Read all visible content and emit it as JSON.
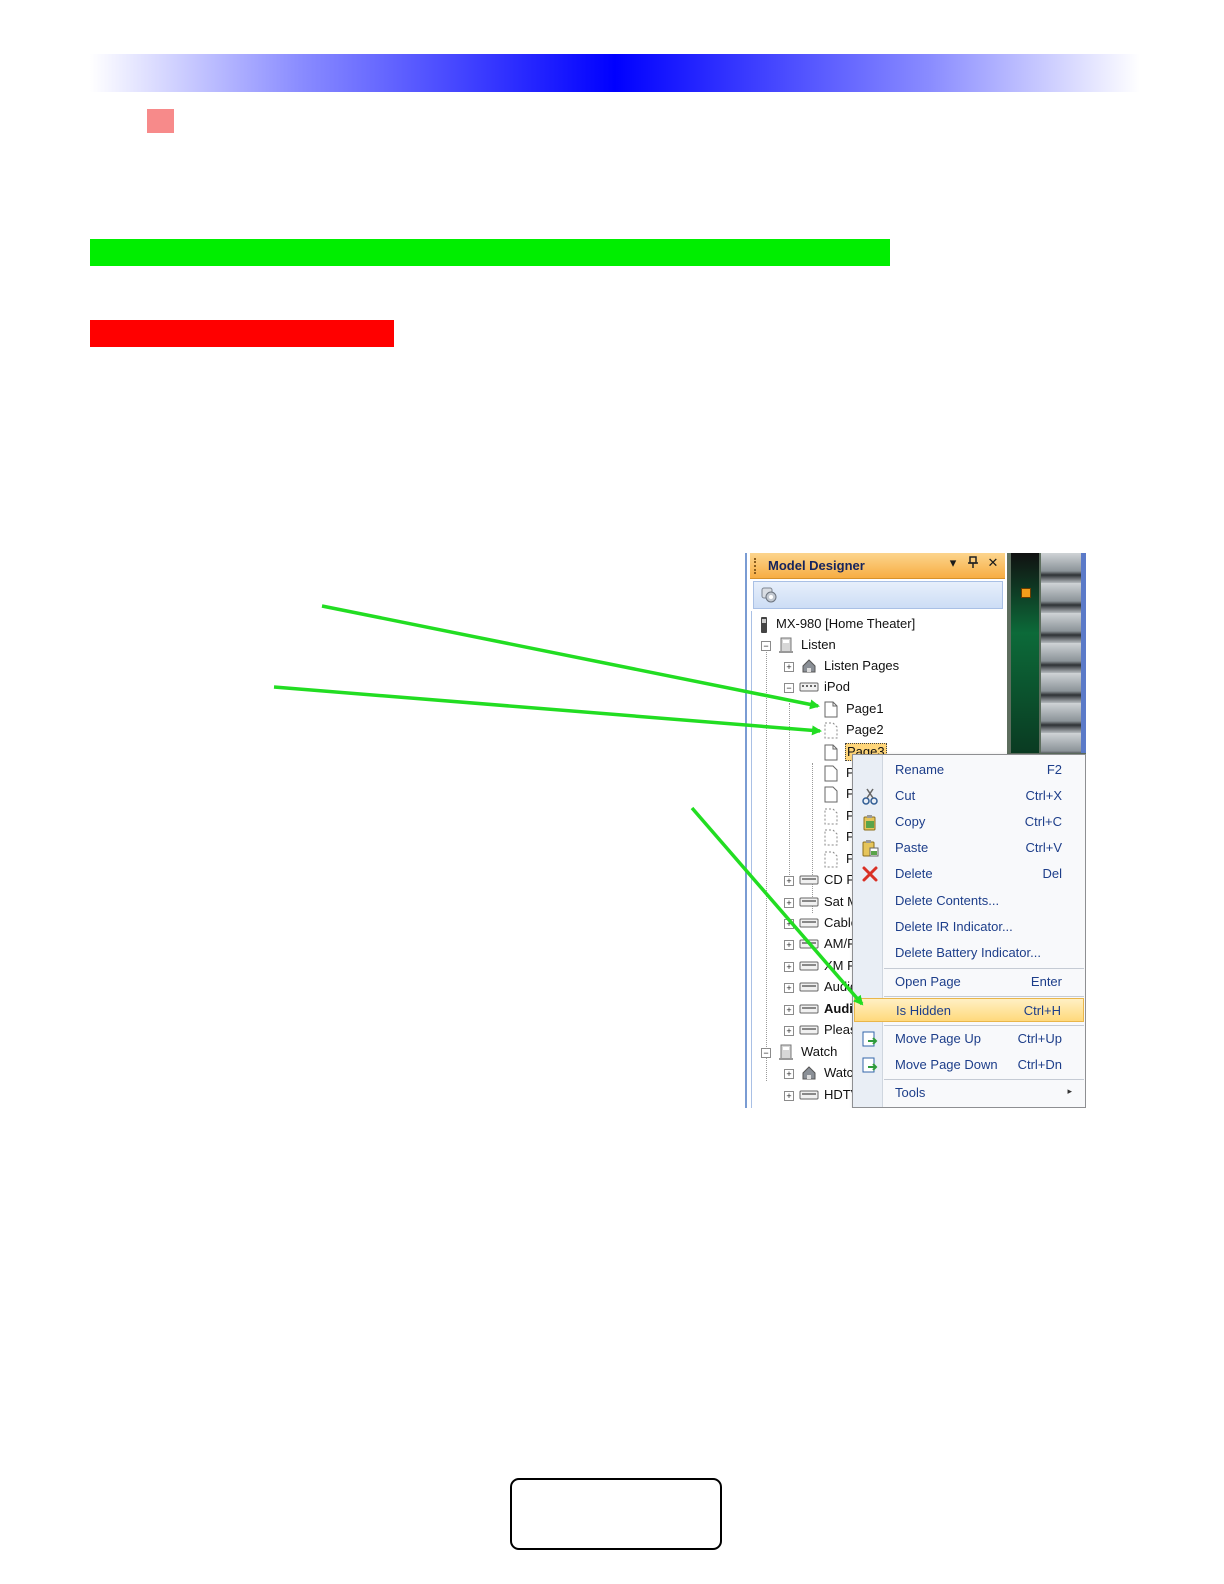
{
  "colors": {
    "header_gradient_center": "#0000ff",
    "green_bar": "#00ee00",
    "red_bar": "#ff0000",
    "bullet": "#f78a8a",
    "arrow": "#22dd22",
    "menu_text": "#1d3e8a"
  },
  "model_designer": {
    "title": "Model Designer",
    "header_buttons": {
      "dropdown": "▾",
      "pin": "ᵖ",
      "close": "✕"
    },
    "toolbar_icon": "tree-settings-icon",
    "tree": {
      "root": "MX-980 [Home Theater]",
      "listen": "Listen",
      "listen_pages": "Listen Pages",
      "ipod": "iPod",
      "page1": "Page1",
      "page2": "Page2",
      "page3": "Page3",
      "p_rows": [
        "P",
        "P",
        "P",
        "P",
        "P"
      ],
      "devices": [
        "CD Pl",
        "Sat M",
        "Cable",
        "AM/F",
        "XM R",
        "Audio",
        "Audi",
        "Pleas"
      ],
      "watch": "Watch",
      "watch_pages": "Watc",
      "hdtv": "HDTV"
    }
  },
  "context_menu": {
    "items": [
      {
        "label": "Rename",
        "shortcut": "F2",
        "icon": ""
      },
      {
        "label": "Cut",
        "shortcut": "Ctrl+X",
        "icon": "scissors-icon"
      },
      {
        "label": "Copy",
        "shortcut": "Ctrl+C",
        "icon": "copy-icon"
      },
      {
        "label": "Paste",
        "shortcut": "Ctrl+V",
        "icon": "paste-icon"
      },
      {
        "label": "Delete",
        "shortcut": "Del",
        "icon": "delete-x-icon"
      },
      {
        "label": "Delete Contents...",
        "shortcut": "",
        "icon": ""
      },
      {
        "label": "Delete IR Indicator...",
        "shortcut": "",
        "icon": ""
      },
      {
        "label": "Delete Battery Indicator...",
        "shortcut": "",
        "icon": ""
      },
      {
        "label": "Open Page",
        "shortcut": "Enter",
        "icon": ""
      },
      {
        "label": "Is Hidden",
        "shortcut": "Ctrl+H",
        "icon": ""
      },
      {
        "label": "Move Page Up",
        "shortcut": "Ctrl+Up",
        "icon": "move-page-up-icon"
      },
      {
        "label": "Move Page Down",
        "shortcut": "Ctrl+Dn",
        "icon": "move-page-down-icon"
      },
      {
        "label": "Tools",
        "shortcut": "",
        "icon": ""
      }
    ],
    "highlighted": "Is Hidden",
    "submenu_glyph": "▸"
  }
}
